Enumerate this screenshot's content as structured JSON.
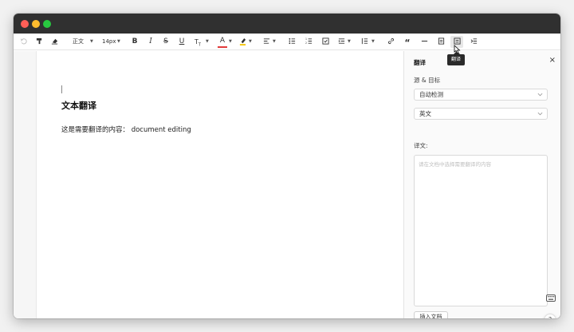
{
  "window": {
    "traffic_lights": {
      "close": "#ff5f57",
      "minimize": "#febc2e",
      "maximize": "#28c840"
    }
  },
  "toolbar": {
    "paragraph_style": "正文",
    "font_size": "14px",
    "tooltip": "翻译",
    "icons": [
      "undo-icon",
      "format-painter-icon",
      "clear-format-icon",
      "bold-icon",
      "italic-icon",
      "strikethrough-icon",
      "underline-icon",
      "text-size-icon",
      "font-color-icon",
      "highlight-icon",
      "align-icon",
      "bullet-list-icon",
      "numbered-list-icon",
      "checkbox-icon",
      "indent-icon",
      "line-height-icon",
      "link-icon",
      "quote-icon",
      "horizontal-rule-icon",
      "export-icon",
      "translate-icon",
      "outline-icon"
    ]
  },
  "editor": {
    "title": "文本翻译",
    "body": "这是需要翻译的内容：  document editing"
  },
  "panel": {
    "title": "翻译",
    "close": "×",
    "source_target_label": "源 & 目标",
    "source_select": "自动检测",
    "target_select": "英文",
    "translation_label": "译文:",
    "textarea_placeholder": "请在文档中选择需要翻译的内容",
    "insert_button": "插入文档",
    "help": "?"
  }
}
